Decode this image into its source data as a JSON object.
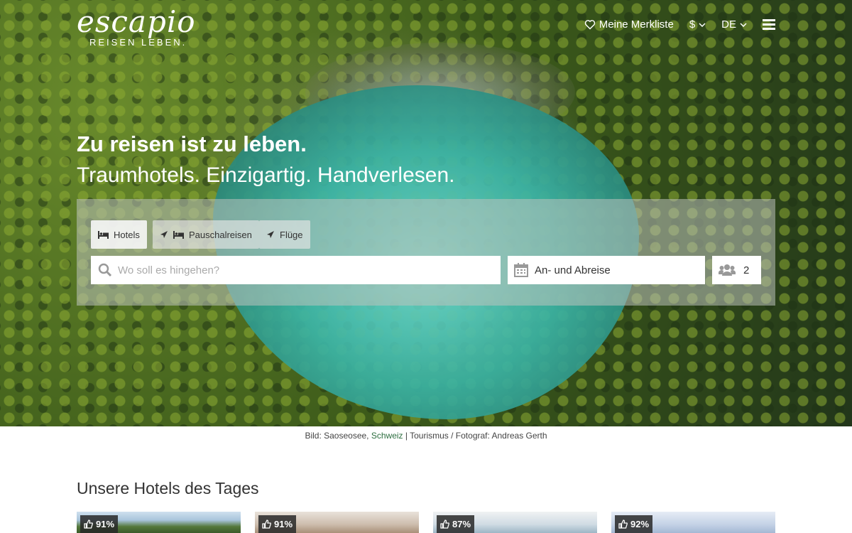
{
  "brand": {
    "logo": "escapio",
    "tagline": "REISEN LEBEN."
  },
  "nav": {
    "wishlist": "Meine Merkliste",
    "currency": "$",
    "language": "DE"
  },
  "hero": {
    "headline": "Zu reisen ist zu leben.",
    "subline": "Traumhotels. Einzigartig. Handverlesen."
  },
  "search": {
    "tabs": [
      {
        "label": "Hotels",
        "active": true
      },
      {
        "label": "Pauschalreisen",
        "active": false
      },
      {
        "label": "Flüge",
        "active": false
      }
    ],
    "destination_placeholder": "Wo soll es hingehen?",
    "dates_label": "An- und Abreise",
    "guests": "2"
  },
  "caption": {
    "prefix": "Bild: Saoseosee,",
    "link": "Schweiz",
    "suffix": "| Tourismus / Fotograf: Andreas Gerth"
  },
  "section_title": "Unsere Hotels des Tages",
  "hotels": [
    {
      "rating": "91%",
      "color": "#3f6e9c"
    },
    {
      "rating": "91%",
      "color": "#b9a896"
    },
    {
      "rating": "87%",
      "color": "#9fb7c7"
    },
    {
      "rating": "92%",
      "color": "#a9bcd6"
    }
  ],
  "colors": {
    "accent_link": "#2c6e3f"
  }
}
